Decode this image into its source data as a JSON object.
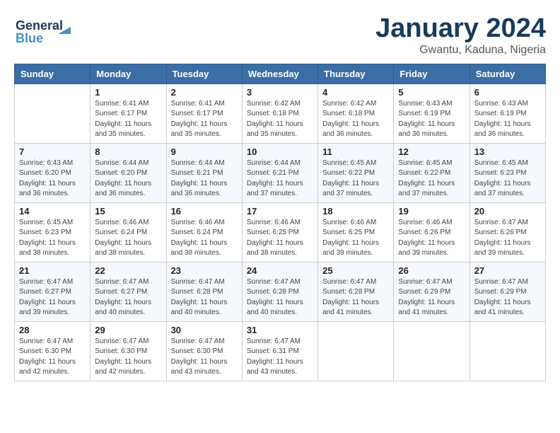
{
  "header": {
    "logo_line1": "General",
    "logo_line2": "Blue",
    "month": "January 2024",
    "location": "Gwantu, Kaduna, Nigeria"
  },
  "weekdays": [
    "Sunday",
    "Monday",
    "Tuesday",
    "Wednesday",
    "Thursday",
    "Friday",
    "Saturday"
  ],
  "weeks": [
    [
      {
        "day": "",
        "info": ""
      },
      {
        "day": "1",
        "info": "Sunrise: 6:41 AM\nSunset: 6:17 PM\nDaylight: 11 hours\nand 35 minutes."
      },
      {
        "day": "2",
        "info": "Sunrise: 6:41 AM\nSunset: 6:17 PM\nDaylight: 11 hours\nand 35 minutes."
      },
      {
        "day": "3",
        "info": "Sunrise: 6:42 AM\nSunset: 6:18 PM\nDaylight: 11 hours\nand 35 minutes."
      },
      {
        "day": "4",
        "info": "Sunrise: 6:42 AM\nSunset: 6:18 PM\nDaylight: 11 hours\nand 36 minutes."
      },
      {
        "day": "5",
        "info": "Sunrise: 6:43 AM\nSunset: 6:19 PM\nDaylight: 11 hours\nand 36 minutes."
      },
      {
        "day": "6",
        "info": "Sunrise: 6:43 AM\nSunset: 6:19 PM\nDaylight: 11 hours\nand 36 minutes."
      }
    ],
    [
      {
        "day": "7",
        "info": "Sunrise: 6:43 AM\nSunset: 6:20 PM\nDaylight: 11 hours\nand 36 minutes."
      },
      {
        "day": "8",
        "info": "Sunrise: 6:44 AM\nSunset: 6:20 PM\nDaylight: 11 hours\nand 36 minutes."
      },
      {
        "day": "9",
        "info": "Sunrise: 6:44 AM\nSunset: 6:21 PM\nDaylight: 11 hours\nand 36 minutes."
      },
      {
        "day": "10",
        "info": "Sunrise: 6:44 AM\nSunset: 6:21 PM\nDaylight: 11 hours\nand 37 minutes."
      },
      {
        "day": "11",
        "info": "Sunrise: 6:45 AM\nSunset: 6:22 PM\nDaylight: 11 hours\nand 37 minutes."
      },
      {
        "day": "12",
        "info": "Sunrise: 6:45 AM\nSunset: 6:22 PM\nDaylight: 11 hours\nand 37 minutes."
      },
      {
        "day": "13",
        "info": "Sunrise: 6:45 AM\nSunset: 6:23 PM\nDaylight: 11 hours\nand 37 minutes."
      }
    ],
    [
      {
        "day": "14",
        "info": "Sunrise: 6:45 AM\nSunset: 6:23 PM\nDaylight: 11 hours\nand 38 minutes."
      },
      {
        "day": "15",
        "info": "Sunrise: 6:46 AM\nSunset: 6:24 PM\nDaylight: 11 hours\nand 38 minutes."
      },
      {
        "day": "16",
        "info": "Sunrise: 6:46 AM\nSunset: 6:24 PM\nDaylight: 11 hours\nand 38 minutes."
      },
      {
        "day": "17",
        "info": "Sunrise: 6:46 AM\nSunset: 6:25 PM\nDaylight: 11 hours\nand 38 minutes."
      },
      {
        "day": "18",
        "info": "Sunrise: 6:46 AM\nSunset: 6:25 PM\nDaylight: 11 hours\nand 39 minutes."
      },
      {
        "day": "19",
        "info": "Sunrise: 6:46 AM\nSunset: 6:26 PM\nDaylight: 11 hours\nand 39 minutes."
      },
      {
        "day": "20",
        "info": "Sunrise: 6:47 AM\nSunset: 6:26 PM\nDaylight: 11 hours\nand 39 minutes."
      }
    ],
    [
      {
        "day": "21",
        "info": "Sunrise: 6:47 AM\nSunset: 6:27 PM\nDaylight: 11 hours\nand 39 minutes."
      },
      {
        "day": "22",
        "info": "Sunrise: 6:47 AM\nSunset: 6:27 PM\nDaylight: 11 hours\nand 40 minutes."
      },
      {
        "day": "23",
        "info": "Sunrise: 6:47 AM\nSunset: 6:28 PM\nDaylight: 11 hours\nand 40 minutes."
      },
      {
        "day": "24",
        "info": "Sunrise: 6:47 AM\nSunset: 6:28 PM\nDaylight: 11 hours\nand 40 minutes."
      },
      {
        "day": "25",
        "info": "Sunrise: 6:47 AM\nSunset: 6:28 PM\nDaylight: 11 hours\nand 41 minutes."
      },
      {
        "day": "26",
        "info": "Sunrise: 6:47 AM\nSunset: 6:29 PM\nDaylight: 11 hours\nand 41 minutes."
      },
      {
        "day": "27",
        "info": "Sunrise: 6:47 AM\nSunset: 6:29 PM\nDaylight: 11 hours\nand 41 minutes."
      }
    ],
    [
      {
        "day": "28",
        "info": "Sunrise: 6:47 AM\nSunset: 6:30 PM\nDaylight: 11 hours\nand 42 minutes."
      },
      {
        "day": "29",
        "info": "Sunrise: 6:47 AM\nSunset: 6:30 PM\nDaylight: 11 hours\nand 42 minutes."
      },
      {
        "day": "30",
        "info": "Sunrise: 6:47 AM\nSunset: 6:30 PM\nDaylight: 11 hours\nand 43 minutes."
      },
      {
        "day": "31",
        "info": "Sunrise: 6:47 AM\nSunset: 6:31 PM\nDaylight: 11 hours\nand 43 minutes."
      },
      {
        "day": "",
        "info": ""
      },
      {
        "day": "",
        "info": ""
      },
      {
        "day": "",
        "info": ""
      }
    ]
  ]
}
